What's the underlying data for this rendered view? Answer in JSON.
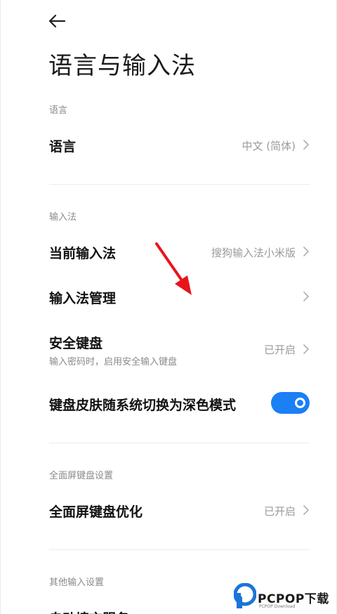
{
  "header": {
    "back_icon": "back-arrow-icon",
    "title": "语言与输入法"
  },
  "sections": {
    "language": {
      "header": "语言",
      "row_language": {
        "label": "语言",
        "value": "中文 (简体)"
      }
    },
    "input_method": {
      "header": "输入法",
      "row_current": {
        "label": "当前输入法",
        "value": "搜狗输入法小米版"
      },
      "row_manage": {
        "label": "输入法管理"
      },
      "row_secure": {
        "label": "安全键盘",
        "sub": "输入密码时，启用安全输入键盘",
        "value": "已开启"
      },
      "row_dark": {
        "label": "键盘皮肤随系统切换为深色模式",
        "toggle_on": true
      }
    },
    "fullscreen": {
      "header": "全面屏键盘设置",
      "row_optimize": {
        "label": "全面屏键盘优化",
        "value": "已开启"
      }
    },
    "other": {
      "header": "其他输入设置",
      "row_autofill": {
        "label": "自动填充服务"
      }
    }
  },
  "watermark": {
    "brand": "PCPOP下载",
    "sub": "PCPOP Download"
  },
  "colors": {
    "accent": "#1b7ff5",
    "annotation_arrow": "#e8141b",
    "watermark_blue": "#1b74d8"
  }
}
